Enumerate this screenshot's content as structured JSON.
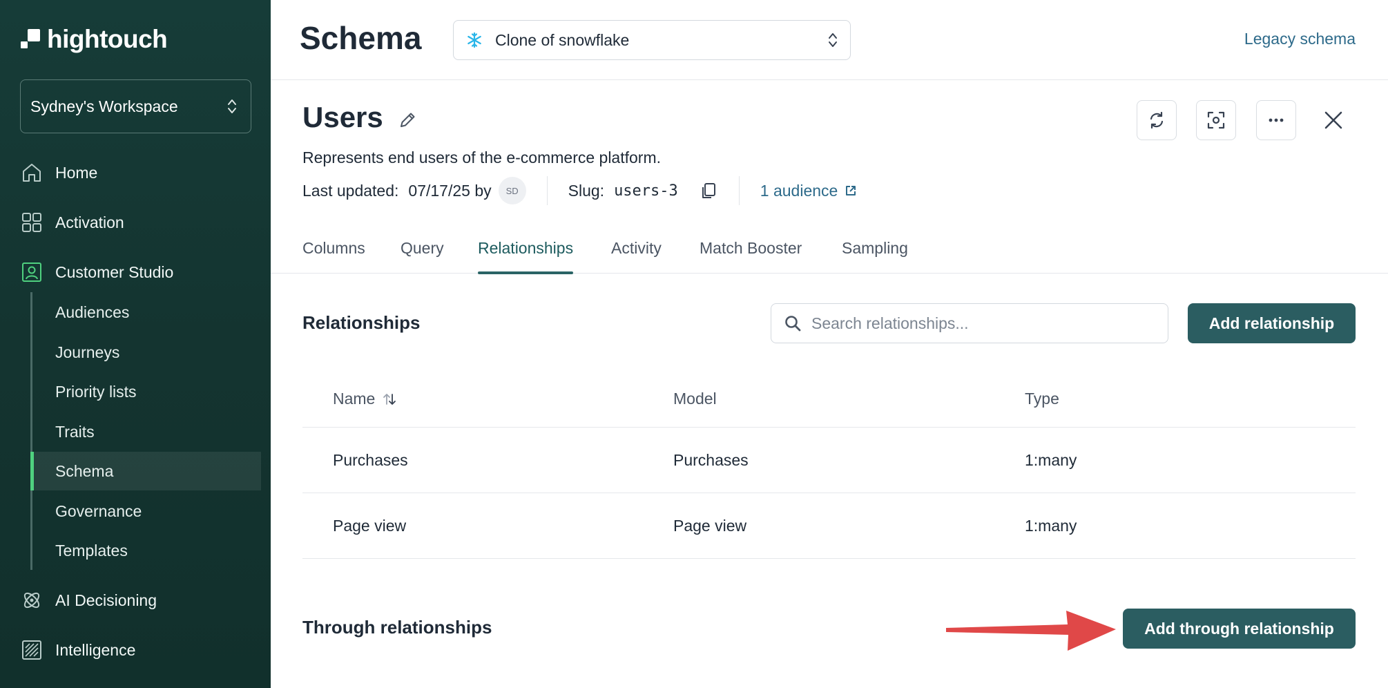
{
  "sidebar": {
    "brand": "hightouch",
    "workspace": "Sydney's Workspace",
    "nav": [
      {
        "label": "Home",
        "icon": "home-icon"
      },
      {
        "label": "Activation",
        "icon": "activation-icon"
      },
      {
        "label": "Customer Studio",
        "icon": "customer-studio-icon"
      },
      {
        "label": "AI Decisioning",
        "icon": "ai-decisioning-icon"
      },
      {
        "label": "Intelligence",
        "icon": "intelligence-icon"
      }
    ],
    "sub_items": [
      "Audiences",
      "Journeys",
      "Priority lists",
      "Traits",
      "Schema",
      "Governance",
      "Templates"
    ],
    "active_sub": "Schema"
  },
  "header": {
    "title": "Schema",
    "source": "Clone of snowflake",
    "legacy_link": "Legacy schema"
  },
  "model": {
    "name": "Users",
    "description": "Represents end users of the e-commerce platform.",
    "last_updated_label": "Last updated:",
    "last_updated_value": "07/17/25 by",
    "avatar_initials": "SD",
    "slug_label": "Slug:",
    "slug_value": "users-3",
    "audience_link": "1 audience"
  },
  "tabs": [
    "Columns",
    "Query",
    "Relationships",
    "Activity",
    "Match Booster",
    "Sampling"
  ],
  "active_tab": "Relationships",
  "relationships": {
    "title": "Relationships",
    "search_placeholder": "Search relationships...",
    "add_button": "Add relationship",
    "columns": [
      "Name",
      "Model",
      "Type"
    ],
    "rows": [
      {
        "name": "Purchases",
        "model": "Purchases",
        "type": "1:many"
      },
      {
        "name": "Page view",
        "model": "Page view",
        "type": "1:many"
      }
    ]
  },
  "through_relationships": {
    "title": "Through relationships",
    "add_button": "Add through relationship"
  },
  "colors": {
    "sidebar_bg": "#143430",
    "accent_green": "#4fd17f",
    "primary_button": "#2b5d61",
    "link": "#2d6a8a",
    "annotation_arrow": "#e04848"
  }
}
